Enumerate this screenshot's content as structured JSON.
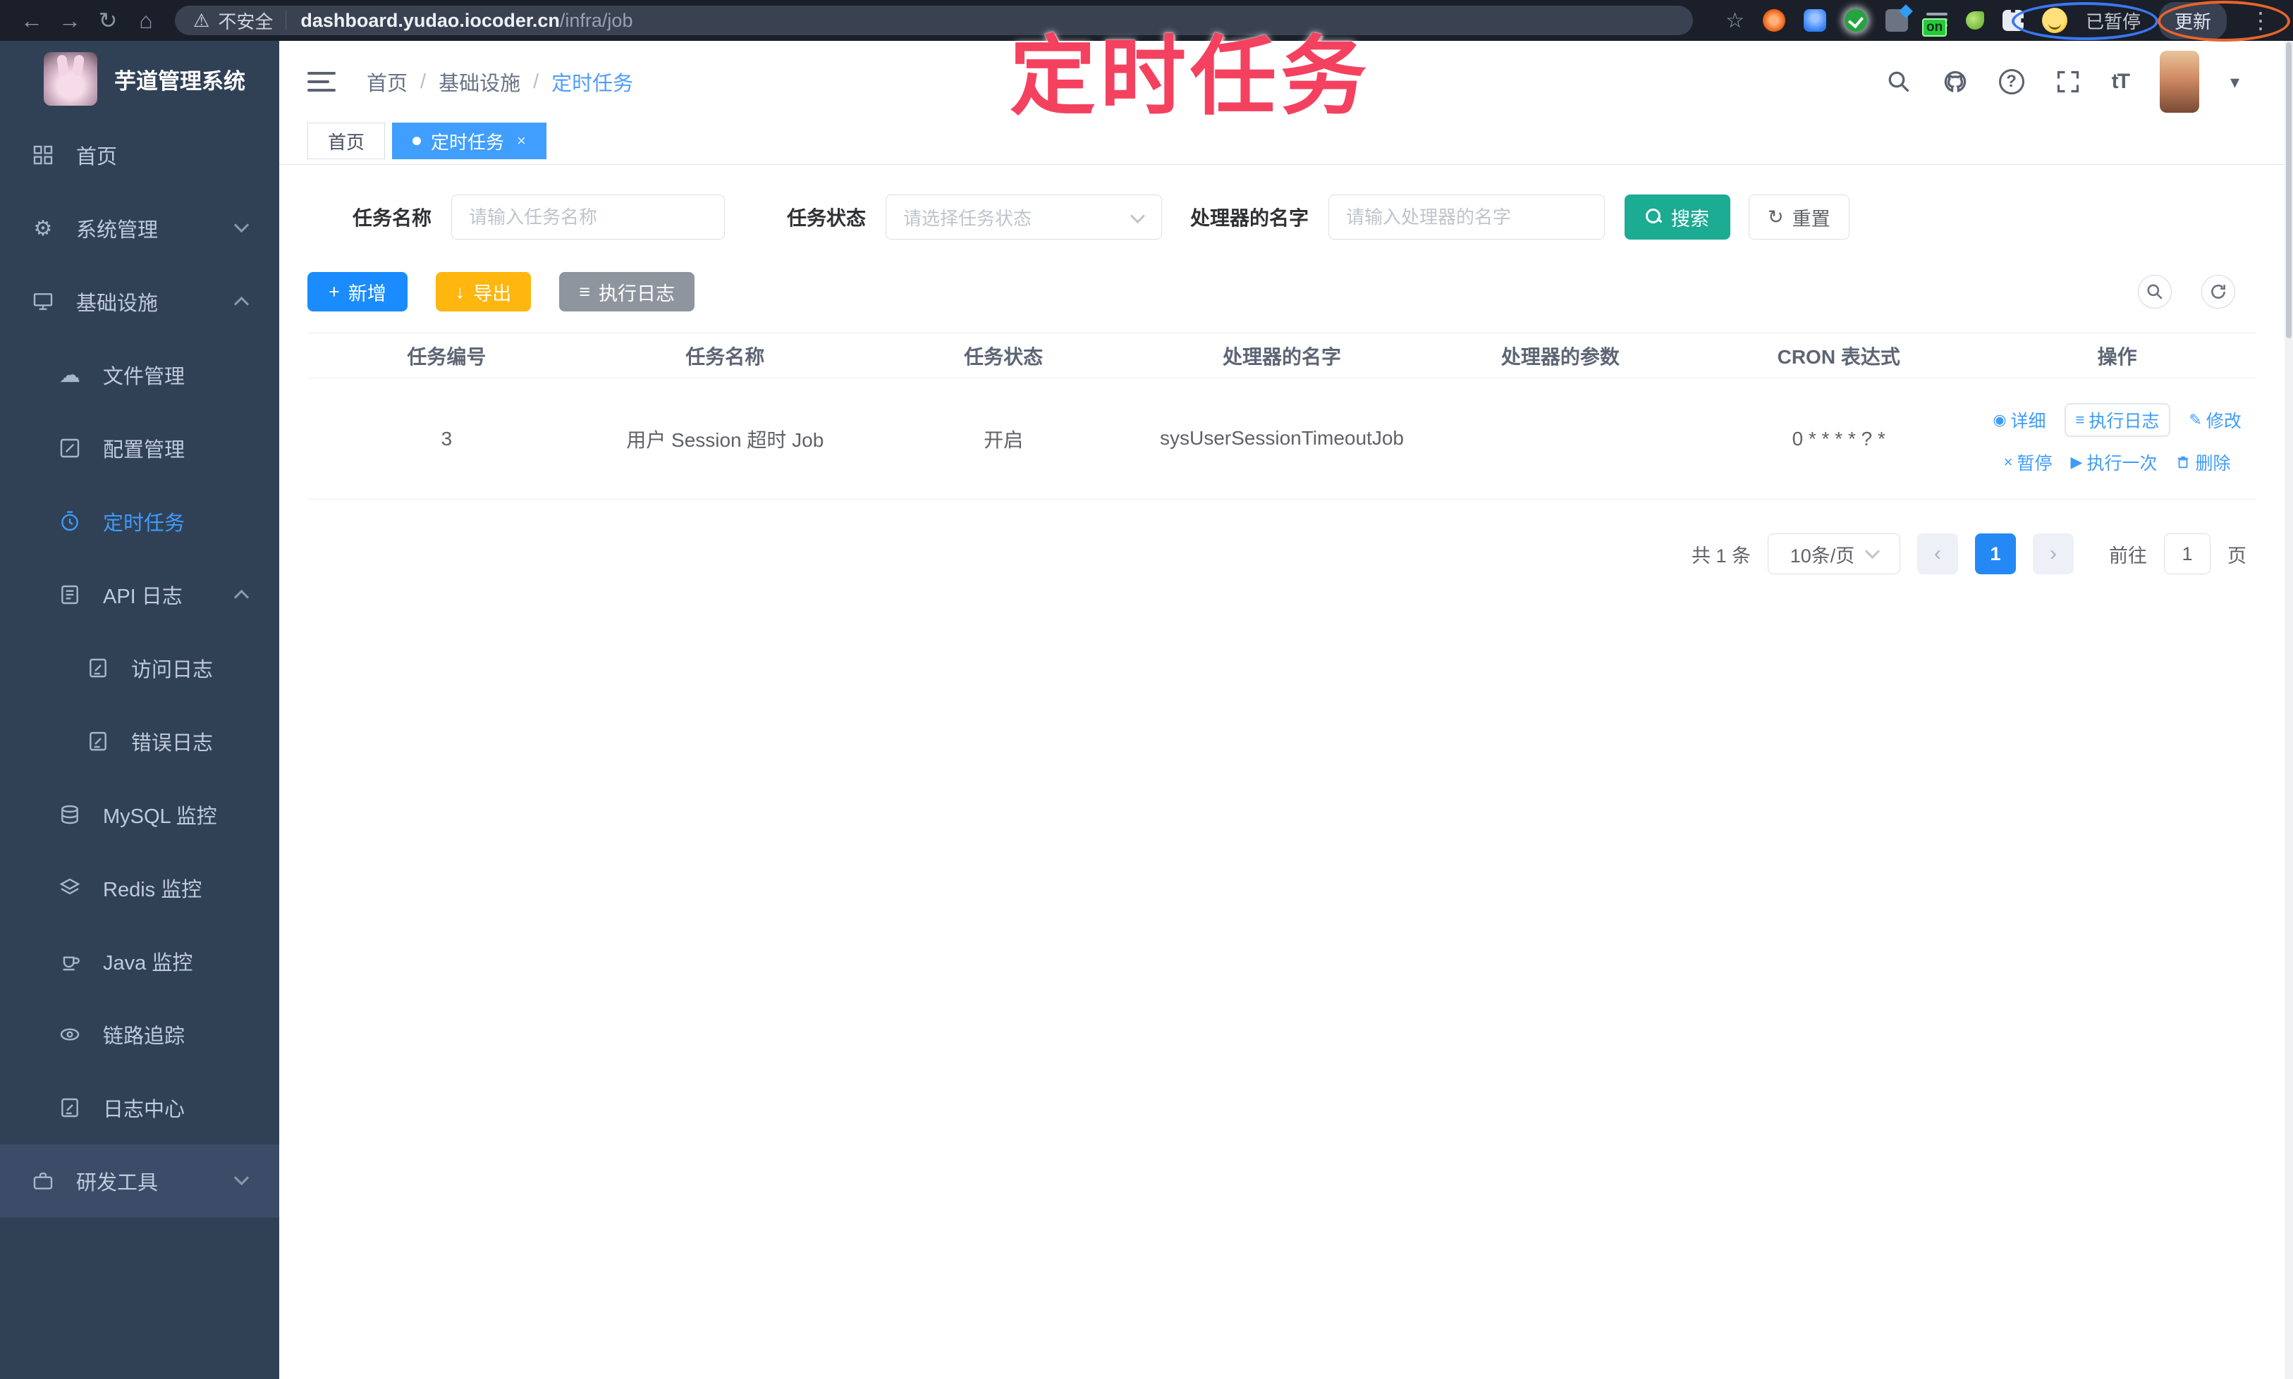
{
  "browser": {
    "security_label": "不安全",
    "url_host": "dashboard.yudao.iocoder.cn",
    "url_path": "/infra/job",
    "extension_on_badge": "on",
    "paused_label": "已暂停",
    "update_label": "更新"
  },
  "icons": {
    "back": "←",
    "forward": "→",
    "reload": "↻",
    "home": "⌂",
    "warning": "⚠",
    "star": "☆",
    "kebab": "⋮",
    "caret_down": "▾",
    "help": "?",
    "font_size": "tT",
    "gear": "⚙",
    "cloud": "☁",
    "edit": "✎",
    "eye": "◉",
    "list": "≡",
    "close": "×",
    "play": "▶",
    "plus": "+",
    "download": "↓",
    "refresh": "↻",
    "prev": "‹",
    "next": "›"
  },
  "watermark_text": "定时任务",
  "sidebar": {
    "app_title": "芋道管理系统",
    "items": [
      {
        "label": "首页"
      },
      {
        "label": "系统管理"
      },
      {
        "label": "基础设施"
      },
      {
        "label": "文件管理"
      },
      {
        "label": "配置管理"
      },
      {
        "label": "定时任务"
      },
      {
        "label": "API 日志"
      },
      {
        "label": "访问日志"
      },
      {
        "label": "错误日志"
      },
      {
        "label": "MySQL 监控"
      },
      {
        "label": "Redis 监控"
      },
      {
        "label": "Java 监控"
      },
      {
        "label": "链路追踪"
      },
      {
        "label": "日志中心"
      },
      {
        "label": "研发工具"
      }
    ]
  },
  "header": {
    "breadcrumb": [
      "首页",
      "基础设施",
      "定时任务"
    ]
  },
  "tabs": [
    {
      "label": "首页"
    },
    {
      "label": "定时任务"
    }
  ],
  "filters": {
    "name_label": "任务名称",
    "name_placeholder": "请输入任务名称",
    "status_label": "任务状态",
    "status_placeholder": "请选择任务状态",
    "handler_label": "处理器的名字",
    "handler_placeholder": "请输入处理器的名字",
    "search_label": "搜索",
    "reset_label": "重置"
  },
  "toolbar": {
    "add_label": "新增",
    "export_label": "导出",
    "exec_log_label": "执行日志"
  },
  "table": {
    "headers": [
      "任务编号",
      "任务名称",
      "任务状态",
      "处理器的名字",
      "处理器的参数",
      "CRON 表达式",
      "操作"
    ],
    "rows": [
      {
        "id": "3",
        "name": "用户 Session 超时 Job",
        "status": "开启",
        "handler": "sysUserSessionTimeoutJob",
        "params": "",
        "cron": "0 * * * * ? *"
      }
    ],
    "row_actions_line1": [
      "详细",
      "执行日志",
      "修改"
    ],
    "row_actions_line2": [
      "暂停",
      "执行一次",
      "删除"
    ]
  },
  "pagination": {
    "total": "共 1 条",
    "page_size": "10条/页",
    "page": "1",
    "goto_label": "前往",
    "goto_value": "1",
    "unit_label": "页"
  },
  "colors": {
    "accent_blue": "#409eff",
    "search_teal": "#1cab93",
    "export_orange": "#ffb60e",
    "exec_gray": "#8f959e",
    "sidebar_bg": "#304156",
    "watermark_pink": "#f4415f"
  }
}
